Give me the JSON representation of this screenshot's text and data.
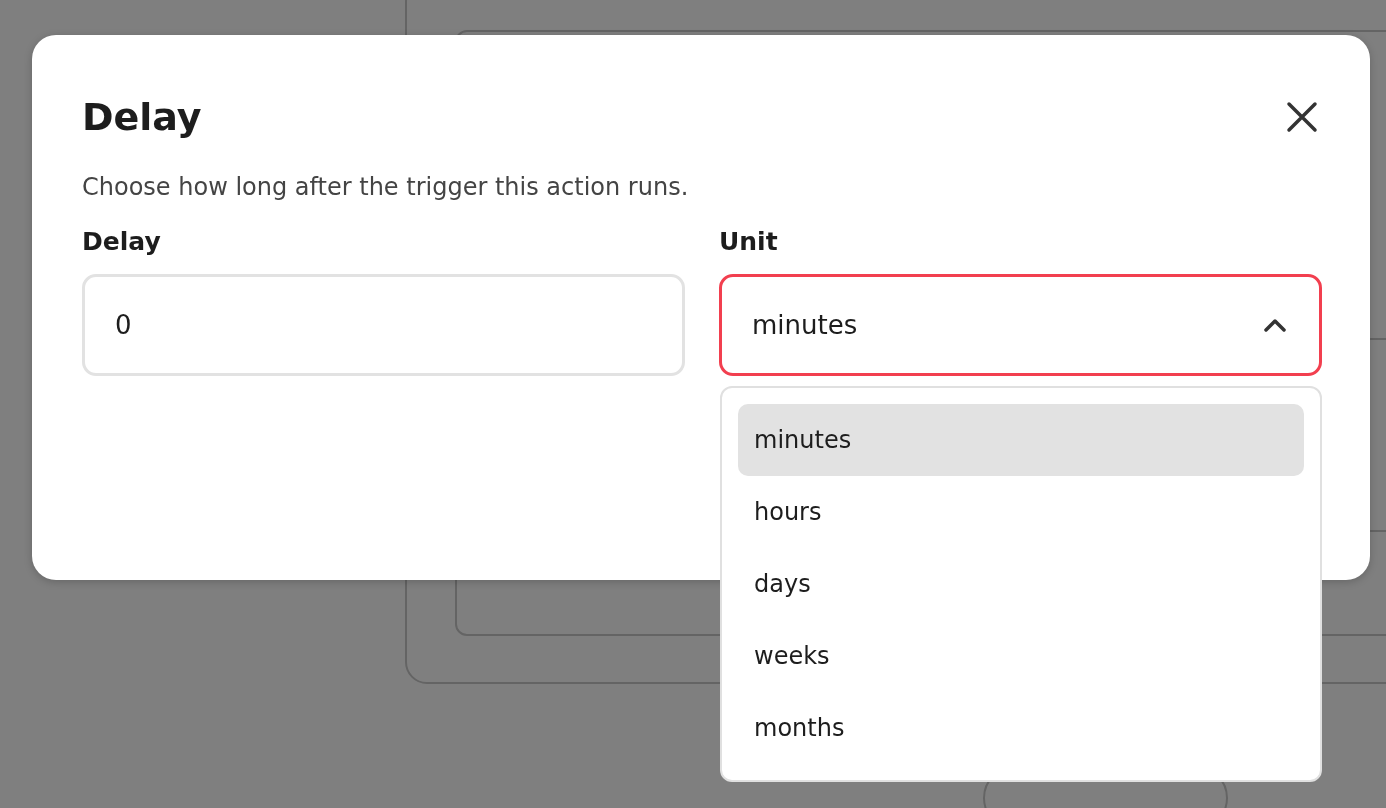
{
  "dialog": {
    "title": "Delay",
    "description": "Choose how long after the trigger this action runs.",
    "delay": {
      "label": "Delay",
      "value": "0"
    },
    "unit": {
      "label": "Unit",
      "value": "minutes",
      "expanded": true,
      "options": [
        {
          "label": "minutes",
          "selected": true
        },
        {
          "label": "hours",
          "selected": false
        },
        {
          "label": "days",
          "selected": false
        },
        {
          "label": "weeks",
          "selected": false
        },
        {
          "label": "months",
          "selected": false
        }
      ]
    }
  }
}
